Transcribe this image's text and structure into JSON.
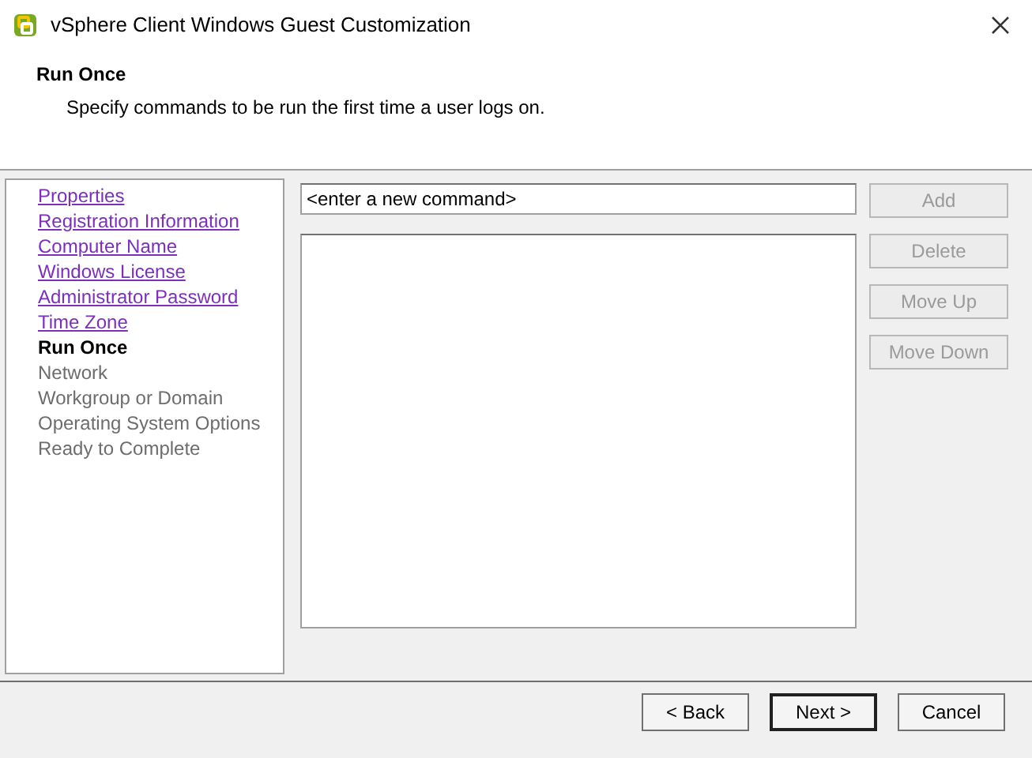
{
  "window": {
    "title": "vSphere Client Windows Guest Customization"
  },
  "header": {
    "title": "Run Once",
    "subtitle": "Specify commands to be run the first time a user logs on."
  },
  "nav": {
    "items": [
      {
        "label": "Properties",
        "kind": "link"
      },
      {
        "label": "Registration Information",
        "kind": "link"
      },
      {
        "label": "Computer Name",
        "kind": "link"
      },
      {
        "label": "Windows License",
        "kind": "link"
      },
      {
        "label": "Administrator Password",
        "kind": "link"
      },
      {
        "label": "Time Zone",
        "kind": "link"
      },
      {
        "label": "Run Once",
        "kind": "current"
      },
      {
        "label": "Network",
        "kind": "pending"
      },
      {
        "label": "Workgroup or Domain",
        "kind": "pending"
      },
      {
        "label": "Operating System Options",
        "kind": "pending"
      },
      {
        "label": "Ready to Complete",
        "kind": "pending"
      }
    ]
  },
  "command_field": {
    "value": "<enter a new command>"
  },
  "side_buttons": [
    {
      "label": "Add",
      "disabled": true
    },
    {
      "label": "Delete",
      "disabled": true
    },
    {
      "label": "Move Up",
      "disabled": true
    },
    {
      "label": "Move Down",
      "disabled": true
    }
  ],
  "footer_buttons": [
    {
      "label": "< Back",
      "default": false
    },
    {
      "label": "Next >",
      "default": true
    },
    {
      "label": "Cancel",
      "default": false
    }
  ]
}
